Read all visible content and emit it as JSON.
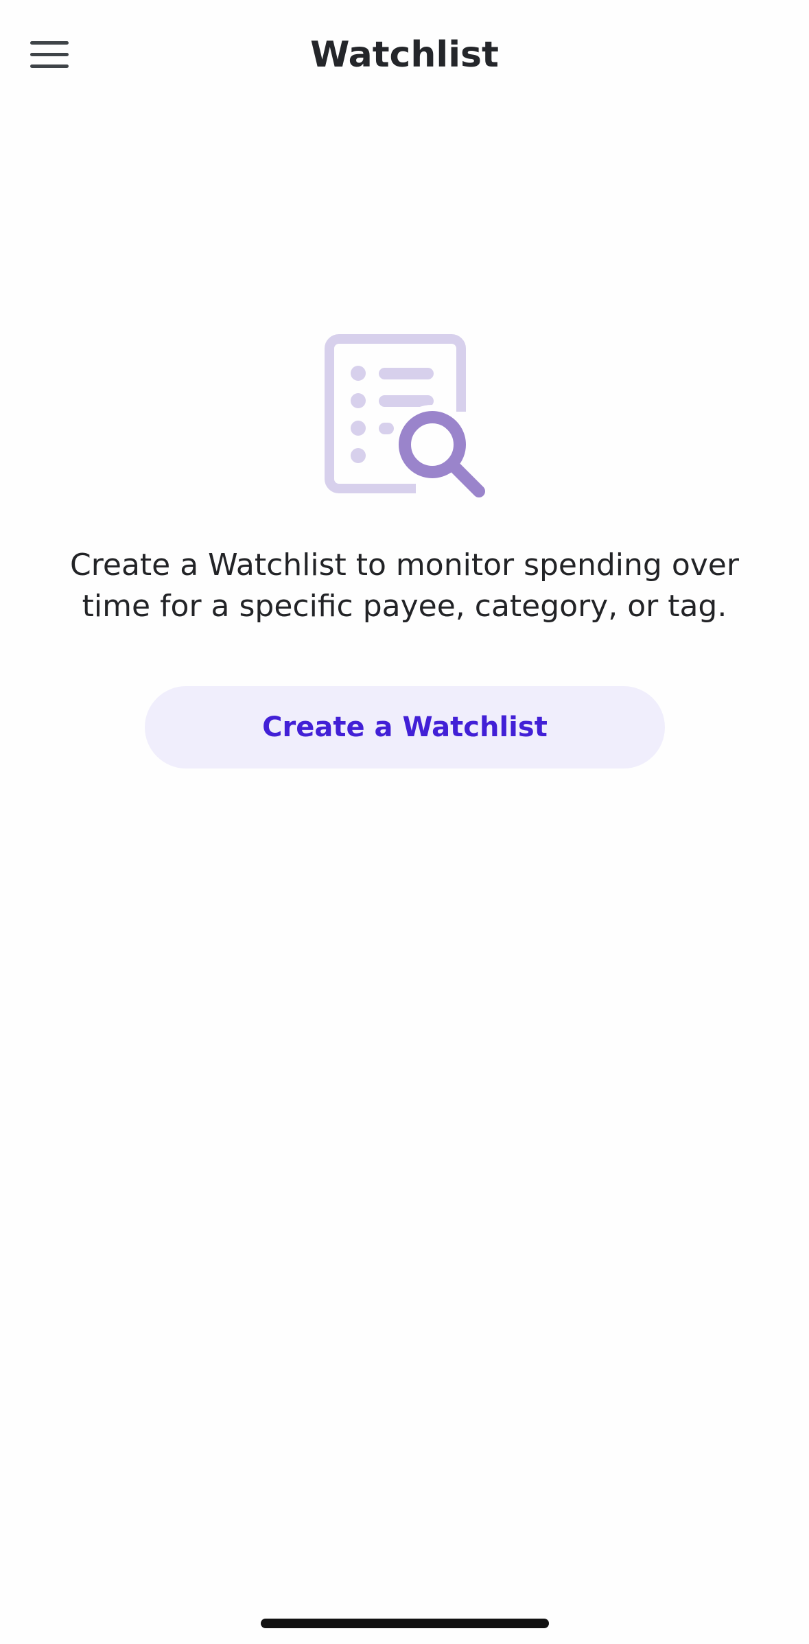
{
  "header": {
    "title": "Watchlist",
    "menu_icon": "hamburger-menu-icon"
  },
  "empty_state": {
    "illustration_icon": "list-search-icon",
    "description": "Create a Watchlist to monitor spending over time for a specific payee, category, or tag.",
    "cta_label": "Create a Watchlist"
  },
  "colors": {
    "accent": "#4220d6",
    "button_background": "#f0eefc",
    "illustration_light": "#d7d0ec",
    "illustration_dark": "#9a84cb"
  }
}
